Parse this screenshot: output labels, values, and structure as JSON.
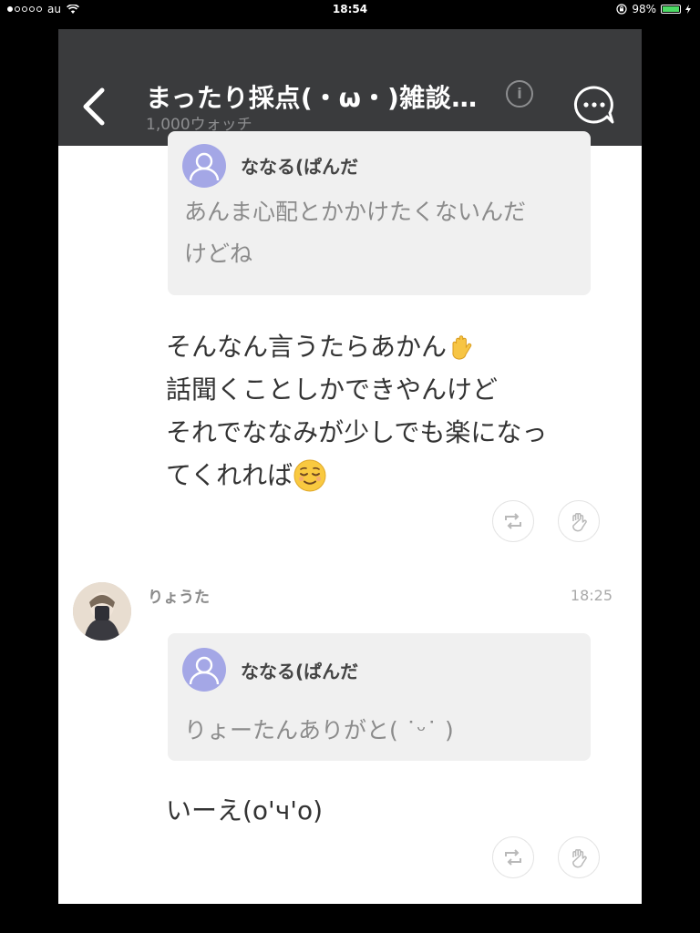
{
  "status_bar": {
    "carrier": "au",
    "time": "18:54",
    "battery_percent": "98%",
    "battery_level": 0.98
  },
  "header": {
    "title": "まったり採点(・ω・)雑談…",
    "subtitle": "1,000ウォッチ",
    "info_label": "i",
    "icons": [
      "back-chevron-icon",
      "info-icon",
      "chat-bubble-icon"
    ]
  },
  "messages": [
    {
      "quote": {
        "name": "ななる(ぱんだ",
        "text_lines": [
          "あんま心配とかかけたくないんだ",
          "けどね"
        ]
      },
      "lines": [
        "そんなん言うたらあかん",
        "話聞くことしかできやんけど",
        "それでななみが少しでも楽になっ",
        "てくれれば"
      ],
      "emojis": [
        "raised-hand-emoji",
        "relieved-face-emoji"
      ]
    },
    {
      "sender": "りょうた",
      "time": "18:25",
      "quote": {
        "name": "ななる(ぱんだ",
        "text_lines": [
          "りょーたんありがと( ˙ᵕ˙ )"
        ]
      },
      "lines": [
        "いーえ(o'ч'o)"
      ]
    }
  ],
  "actions": {
    "icons": [
      "repost-icon",
      "clap-icon"
    ]
  },
  "colors": {
    "header_bg": "#3a3b3d",
    "quote_bg": "#f0f0f0",
    "default_avatar": "#a4a7e6",
    "battery": "#4cd964"
  }
}
